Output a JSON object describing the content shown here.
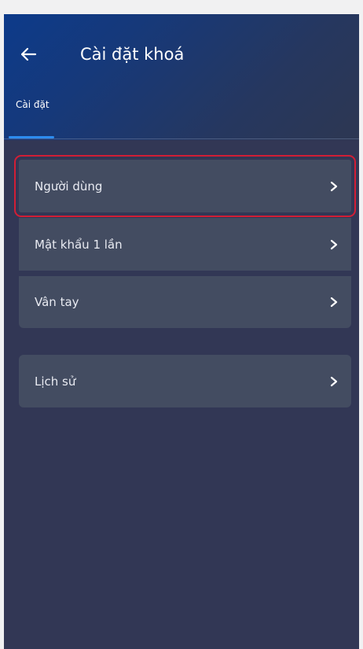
{
  "header": {
    "title": "Cài đặt khoá",
    "back_icon": "arrow-left-icon"
  },
  "tabs": [
    {
      "label": "Cài đặt",
      "active": true
    }
  ],
  "menu": {
    "items": [
      {
        "label": "Người dùng",
        "icon": "chevron-right-icon",
        "selected": true
      },
      {
        "label": "Mật khẩu 1 lần",
        "icon": "chevron-right-icon"
      },
      {
        "label": "Vân tay",
        "icon": "chevron-right-icon"
      },
      {
        "label": "Lịch sử",
        "icon": "chevron-right-icon"
      }
    ]
  },
  "colors": {
    "background": "#323755",
    "card": "#434c61",
    "accent": "#2d8cf0",
    "highlight": "#d21e35"
  }
}
